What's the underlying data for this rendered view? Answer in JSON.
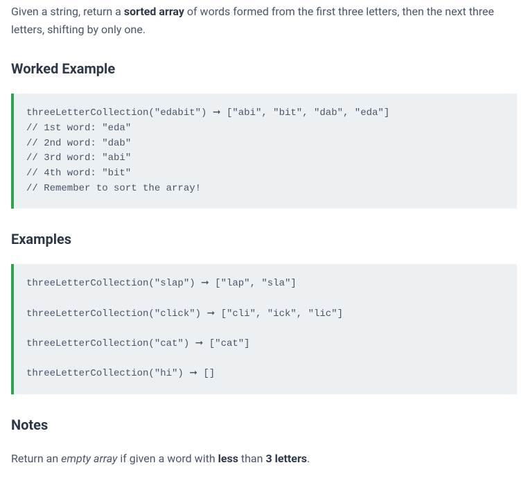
{
  "intro": {
    "prefix": "Given a string, return a ",
    "bold1": "sorted array",
    "mid": " of words formed from the first three letters, then the next three letters, shifting by only one."
  },
  "workedHeading": "Worked Example",
  "workedCode": "threeLetterCollection(\"edabit\") ➞ [\"abi\", \"bit\", \"dab\", \"eda\"]\n// 1st word: \"eda\"\n// 2nd word: \"dab\"\n// 3rd word: \"abi\"\n// 4th word: \"bit\"\n// Remember to sort the array!",
  "examplesHeading": "Examples",
  "examplesCode": "threeLetterCollection(\"slap\") ➞ [\"lap\", \"sla\"]\n\nthreeLetterCollection(\"click\") ➞ [\"cli\", \"ick\", \"lic\"]\n\nthreeLetterCollection(\"cat\") ➞ [\"cat\"]\n\nthreeLetterCollection(\"hi\") ➞ []",
  "notesHeading": "Notes",
  "notes": {
    "prefix": "Return an ",
    "em": "empty array",
    "mid": " if given a word with ",
    "bold1": "less",
    "mid2": " than ",
    "bold2": "3 letters",
    "suffix": "."
  }
}
